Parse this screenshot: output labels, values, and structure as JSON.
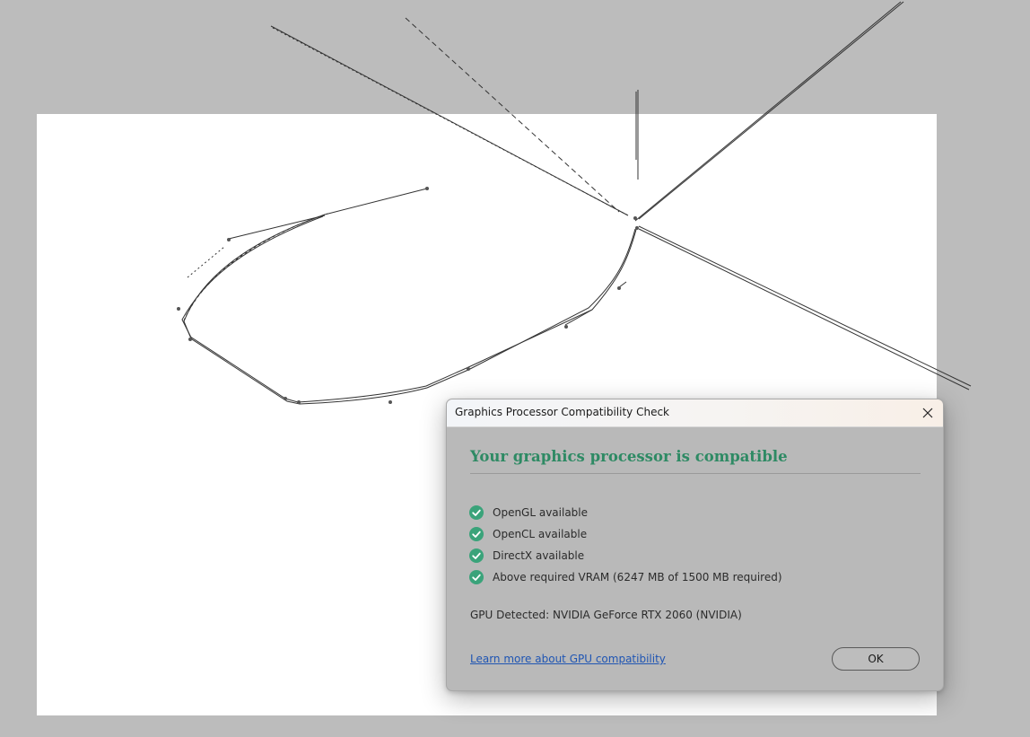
{
  "dialog": {
    "title": "Graphics Processor Compatibility Check",
    "heading": "Your graphics processor is compatible",
    "checks": [
      {
        "label": "OpenGL available"
      },
      {
        "label": "OpenCL available"
      },
      {
        "label": "DirectX available"
      },
      {
        "label": "Above required VRAM (6247 MB of 1500 MB required)"
      }
    ],
    "gpu_detected": "GPU Detected: NVIDIA GeForce RTX 2060 (NVIDIA)",
    "learn_more_link": "Learn more about GPU compatibility",
    "ok_label": "OK"
  },
  "colors": {
    "heading": "#2e8a64",
    "check_icon": "#3aa37a",
    "link": "#1f55b3",
    "dialog_body": "#b9b9b9",
    "backdrop": "#bcbcbc",
    "canvas": "#ffffff"
  },
  "icons": {
    "close": "close-icon",
    "check": "check-circle-icon"
  }
}
